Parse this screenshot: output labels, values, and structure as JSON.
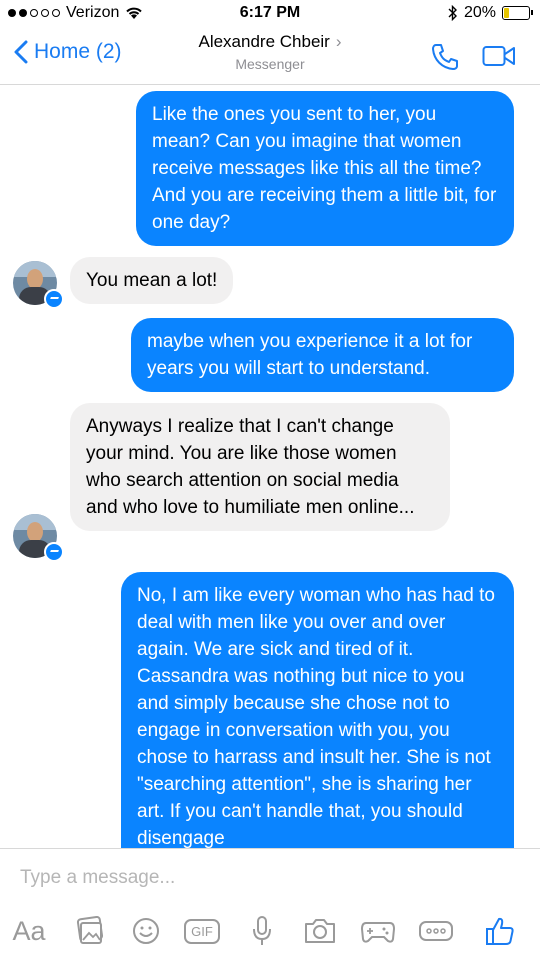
{
  "status_bar": {
    "carrier": "Verizon",
    "time": "6:17 PM",
    "battery": "20%",
    "battery_level": 0.2
  },
  "nav": {
    "back_label": "Home (2)",
    "contact_name": "Alexandre Chbeir",
    "subtitle": "Messenger",
    "icons": [
      "chevron-left-icon",
      "chevron-right-icon",
      "phone-icon",
      "video-icon"
    ]
  },
  "messages": [
    {
      "from": "me",
      "text": "Like the ones you sent to her, you mean?  Can you imagine that women receive messages like this all the time?  And you are receiving them a little bit, for one day?"
    },
    {
      "from": "them",
      "text": "You mean a lot!"
    },
    {
      "from": "me",
      "text": "maybe when you experience it a lot for years you will start to understand."
    },
    {
      "from": "them",
      "text": "Anyways I realize that I can't change your mind. You are like those women who search attention on social media and who love to humiliate men online..."
    },
    {
      "from": "me",
      "text": "No, I am like every woman who has had to deal with men like you over and over again.  We are sick and tired of it.  Cassandra was nothing but nice to you and simply because she chose not to engage in conversation with you, you chose to harrass and insult her.  She is not \"searching attention\", she is sharing her art.  If you can't handle that, you should disengage"
    }
  ],
  "composer": {
    "placeholder": "Type a message...",
    "aa_label": "Aa",
    "gif_label": "GIF",
    "tools": [
      "aa",
      "photo-icon",
      "emoji-icon",
      "gif-icon",
      "microphone-icon",
      "camera-icon",
      "game-icon",
      "more-icon",
      "like-icon"
    ]
  },
  "colors": {
    "accent": "#0a84ff",
    "incoming_bubble": "#f1f0f0",
    "muted": "#8e8e93"
  }
}
